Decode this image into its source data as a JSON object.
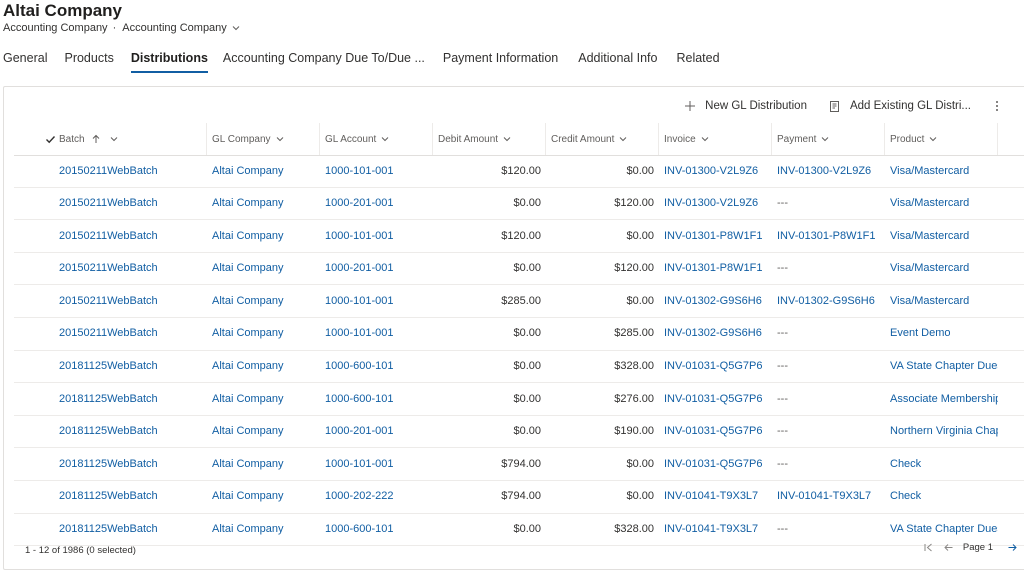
{
  "header": {
    "title": "Altai Company",
    "entity_type": "Accounting Company",
    "separator": "·",
    "form_selector": "Accounting Company"
  },
  "tabs": [
    {
      "label": "General",
      "active": false
    },
    {
      "label": "Products",
      "active": false
    },
    {
      "label": "Distributions",
      "active": true
    },
    {
      "label": "Accounting Company Due To/Due ...",
      "active": false
    },
    {
      "label": "Payment Information",
      "active": false
    },
    {
      "label": "Additional Info",
      "active": false
    },
    {
      "label": "Related",
      "active": false
    }
  ],
  "commands": {
    "new_label": "New GL Distribution",
    "add_existing_label": "Add Existing GL Distri..."
  },
  "columns": [
    "Batch",
    "GL Company",
    "GL Account",
    "Debit Amount",
    "Credit Amount",
    "Invoice",
    "Payment",
    "Product"
  ],
  "rows": [
    [
      "20150211WebBatch",
      "Altai Company",
      "1000-101-001",
      "$120.00",
      "$0.00",
      "INV-01300-V2L9Z6",
      "INV-01300-V2L9Z6",
      "Visa/Mastercard"
    ],
    [
      "20150211WebBatch",
      "Altai Company",
      "1000-201-001",
      "$0.00",
      "$120.00",
      "INV-01300-V2L9Z6",
      "---",
      "Visa/Mastercard"
    ],
    [
      "20150211WebBatch",
      "Altai Company",
      "1000-101-001",
      "$120.00",
      "$0.00",
      "INV-01301-P8W1F1",
      "INV-01301-P8W1F1",
      "Visa/Mastercard"
    ],
    [
      "20150211WebBatch",
      "Altai Company",
      "1000-201-001",
      "$0.00",
      "$120.00",
      "INV-01301-P8W1F1",
      "---",
      "Visa/Mastercard"
    ],
    [
      "20150211WebBatch",
      "Altai Company",
      "1000-101-001",
      "$285.00",
      "$0.00",
      "INV-01302-G9S6H6",
      "INV-01302-G9S6H6",
      "Visa/Mastercard"
    ],
    [
      "20150211WebBatch",
      "Altai Company",
      "1000-101-001",
      "$0.00",
      "$285.00",
      "INV-01302-G9S6H6",
      "---",
      "Event Demo"
    ],
    [
      "20181125WebBatch",
      "Altai Company",
      "1000-600-101",
      "$0.00",
      "$328.00",
      "INV-01031-Q5G7P6",
      "---",
      "VA State Chapter Dues"
    ],
    [
      "20181125WebBatch",
      "Altai Company",
      "1000-600-101",
      "$0.00",
      "$276.00",
      "INV-01031-Q5G7P6",
      "---",
      "Associate Membership"
    ],
    [
      "20181125WebBatch",
      "Altai Company",
      "1000-201-001",
      "$0.00",
      "$190.00",
      "INV-01031-Q5G7P6",
      "---",
      "Northern Virginia Chapter"
    ],
    [
      "20181125WebBatch",
      "Altai Company",
      "1000-101-001",
      "$794.00",
      "$0.00",
      "INV-01031-Q5G7P6",
      "---",
      "Check"
    ],
    [
      "20181125WebBatch",
      "Altai Company",
      "1000-202-222",
      "$794.00",
      "$0.00",
      "INV-01041-T9X3L7",
      "INV-01041-T9X3L7",
      "Check"
    ],
    [
      "20181125WebBatch",
      "Altai Company",
      "1000-600-101",
      "$0.00",
      "$328.00",
      "INV-01041-T9X3L7",
      "---",
      "VA State Chapter Dues"
    ]
  ],
  "footer": {
    "record_count": "1 - 12 of 1986 (0 selected)",
    "page_label": "Page 1"
  },
  "colors": {
    "link": "#115ea3",
    "active_tab_underline": "#115ea3",
    "text": "#323130",
    "border": "#e1dfdd"
  },
  "icons": [
    "chevron-down-icon",
    "plus-icon",
    "add-existing-icon",
    "more-vertical-icon",
    "checkmark-icon",
    "sort-ascending-icon",
    "first-page-icon",
    "previous-page-icon",
    "next-page-icon"
  ]
}
